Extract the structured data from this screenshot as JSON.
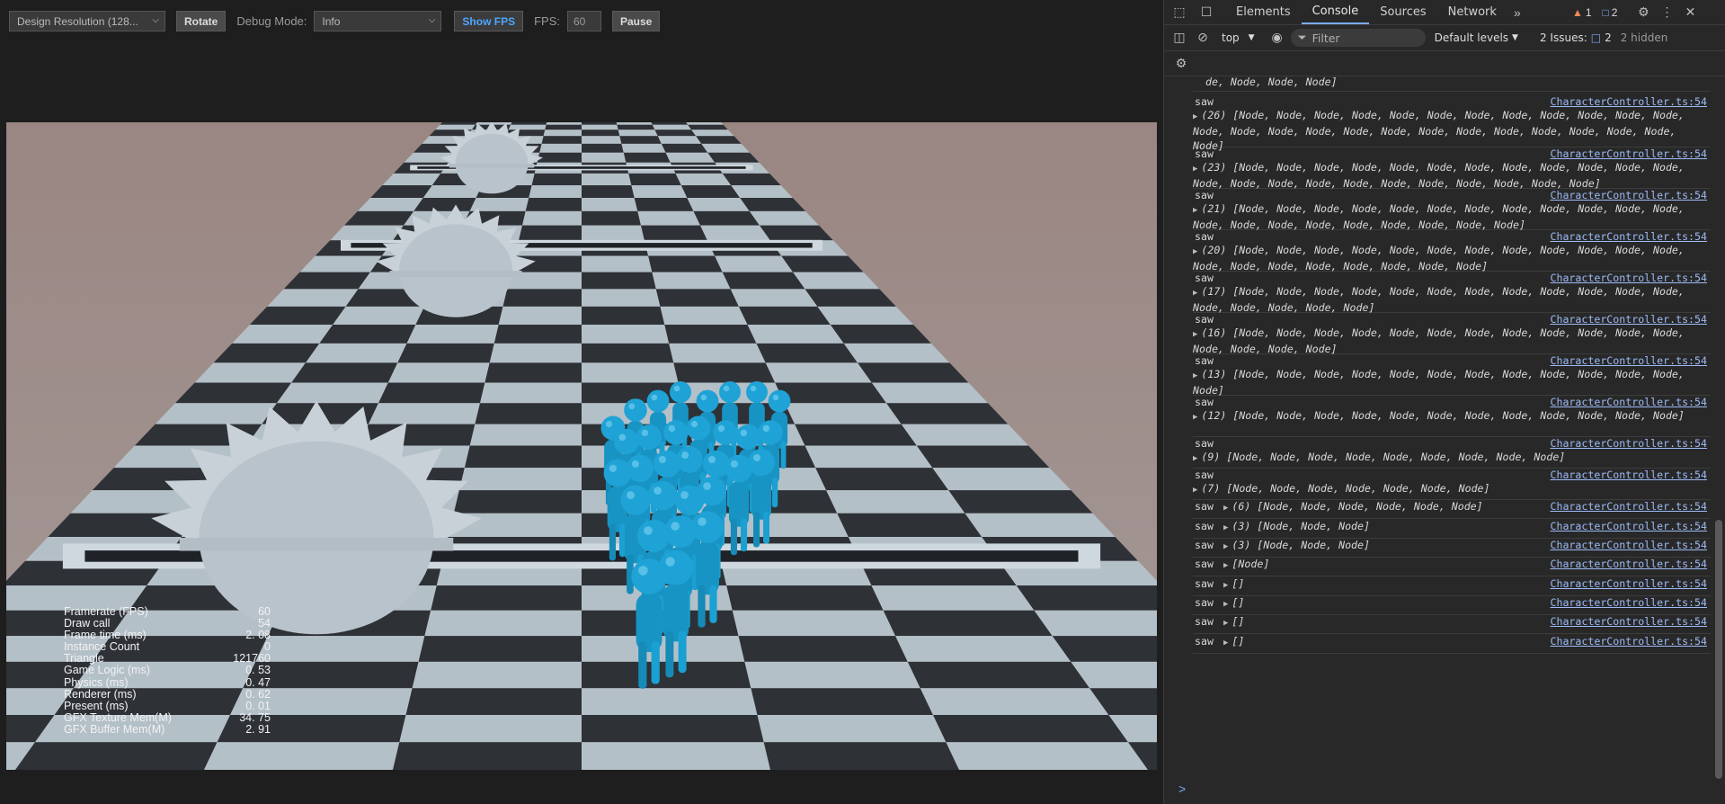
{
  "toolbar": {
    "design_resolution": "Design Resolution (128...",
    "rotate": "Rotate",
    "debug_mode_label": "Debug Mode:",
    "debug_mode_value": "Info",
    "show_fps": "Show FPS",
    "fps_label": "FPS:",
    "fps_value": "60",
    "pause": "Pause"
  },
  "stats": [
    {
      "label": "Framerate (FPS)",
      "value": "60"
    },
    {
      "label": "Draw call",
      "value": "54"
    },
    {
      "label": "Frame time (ms)",
      "value": "2. 08"
    },
    {
      "label": "Instance Count",
      "value": "0"
    },
    {
      "label": "Triangle",
      "value": "121760"
    },
    {
      "label": "Game Logic (ms)",
      "value": "0. 53"
    },
    {
      "label": "Physics (ms)",
      "value": "0. 47"
    },
    {
      "label": "Renderer (ms)",
      "value": "0. 62"
    },
    {
      "label": "Present (ms)",
      "value": "0. 01"
    },
    {
      "label": "GFX Texture Mem(M)",
      "value": "34. 75"
    },
    {
      "label": "GFX Buffer Mem(M)",
      "value": "2. 91"
    }
  ],
  "devtools": {
    "tabs": [
      "Elements",
      "Console",
      "Sources",
      "Network"
    ],
    "warnings": "1",
    "messages": "2",
    "context": "top",
    "filter_placeholder": "Filter",
    "levels": "Default levels",
    "issues_label": "2 Issues:",
    "issues_count": "2",
    "hidden": "2 hidden"
  },
  "console": {
    "source": "CharacterController.ts:54",
    "word": "saw",
    "top_fragment": "de, Node, Node, Node]",
    "entries": [
      {
        "count": "(26)",
        "text": "[Node, Node, Node, Node, Node, Node, Node, Node, Node, Node, Node, Node, Node, Node, Node, Node, Node, Node, Node, Node, Node, Node, Node, Node, Node, Node]"
      },
      {
        "count": "(23)",
        "text": "[Node, Node, Node, Node, Node, Node, Node, Node, Node, Node, Node, Node, Node, Node, Node, Node, Node, Node, Node, Node, Node, Node, Node]"
      },
      {
        "count": "(21)",
        "text": "[Node, Node, Node, Node, Node, Node, Node, Node, Node, Node, Node, Node, Node, Node, Node, Node, Node, Node, Node, Node, Node]"
      },
      {
        "count": "(20)",
        "text": "[Node, Node, Node, Node, Node, Node, Node, Node, Node, Node, Node, Node, Node, Node, Node, Node, Node, Node, Node, Node]"
      },
      {
        "count": "(17)",
        "text": "[Node, Node, Node, Node, Node, Node, Node, Node, Node, Node, Node, Node, Node, Node, Node, Node, Node]"
      },
      {
        "count": "(16)",
        "text": "[Node, Node, Node, Node, Node, Node, Node, Node, Node, Node, Node, Node, Node, Node, Node, Node]"
      },
      {
        "count": "(13)",
        "text": "[Node, Node, Node, Node, Node, Node, Node, Node, Node, Node, Node, Node, Node]"
      },
      {
        "count": "(12)",
        "text": "[Node, Node, Node, Node, Node, Node, Node, Node, Node, Node, Node, Node]"
      },
      {
        "count": "(9)",
        "text": "[Node, Node, Node, Node, Node, Node, Node, Node, Node]"
      },
      {
        "count": "(7)",
        "text": "[Node, Node, Node, Node, Node, Node, Node]"
      },
      {
        "count": "(6)",
        "text": "[Node, Node, Node, Node, Node, Node]"
      },
      {
        "count": "(3)",
        "text": "[Node, Node, Node]"
      },
      {
        "count": "(3)",
        "text": "[Node, Node, Node]"
      },
      {
        "count": "",
        "text": "[Node]"
      },
      {
        "count": "",
        "text": "[]"
      },
      {
        "count": "",
        "text": "[]"
      },
      {
        "count": "",
        "text": "[]"
      },
      {
        "count": "",
        "text": "[]"
      }
    ],
    "prompt": ">"
  },
  "colors": {
    "character": "#1fa3d6",
    "board_dark": "#2e3237",
    "board_light": "#b4c0c8",
    "sky": "#a08f8a",
    "link": "#9dbaf6",
    "accent": "#7cacf8"
  }
}
